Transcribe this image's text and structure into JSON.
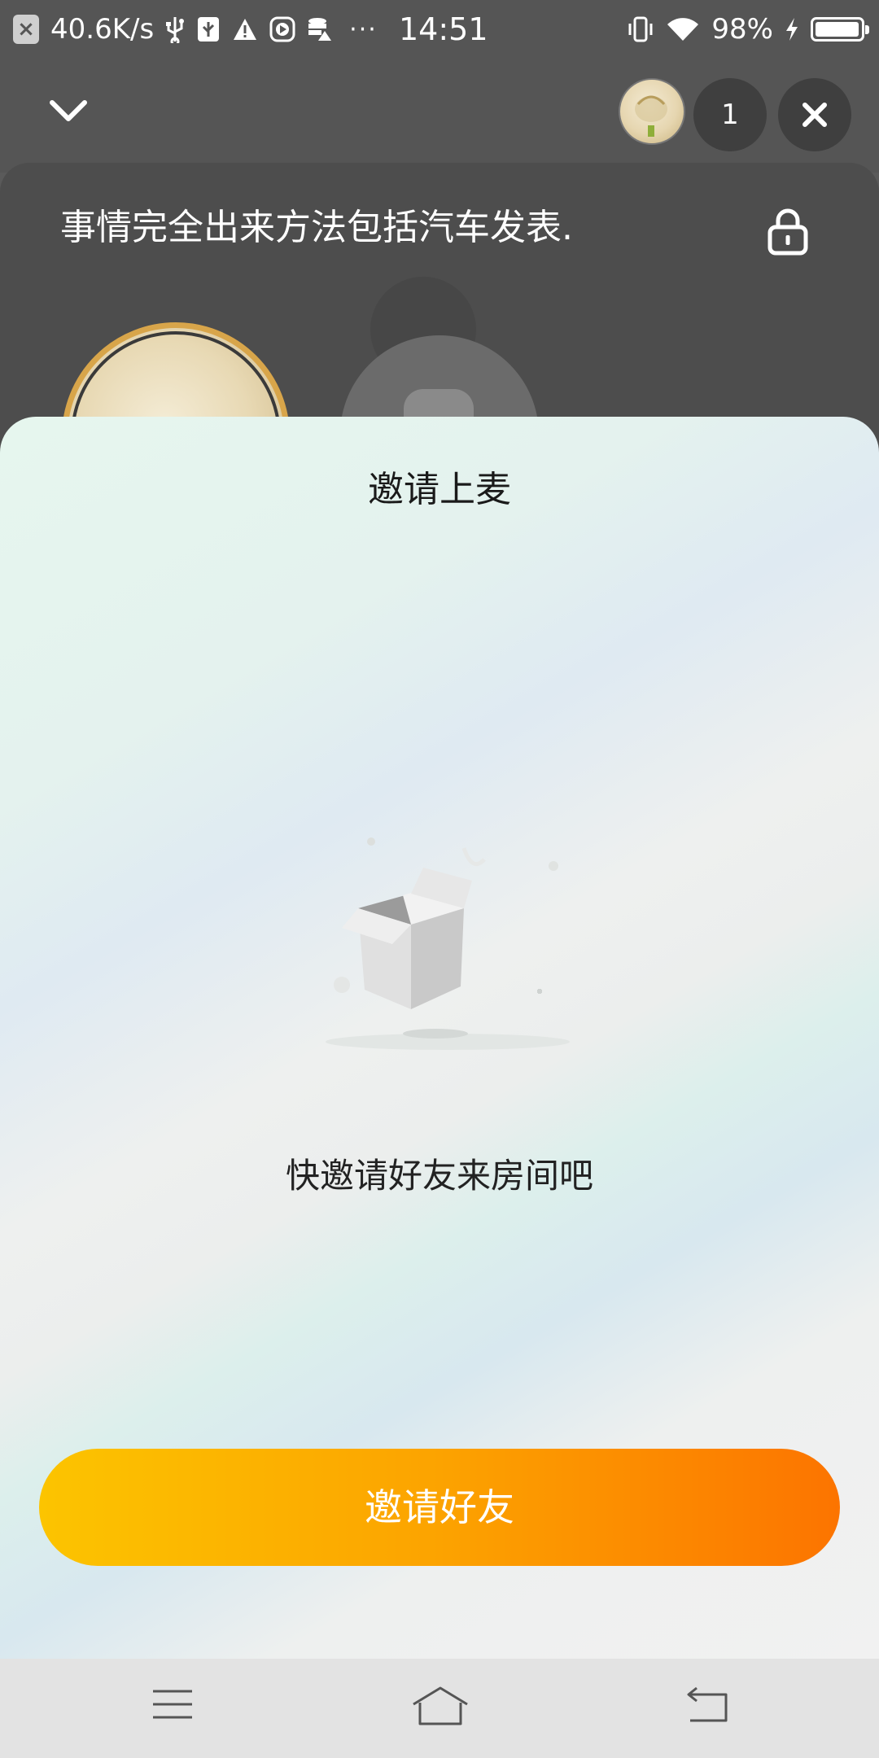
{
  "status_bar": {
    "net_speed": "40.6K/s",
    "time": "14:51",
    "battery": "98%",
    "battery_level": 0.98,
    "overflow": "···",
    "icons": [
      "close-notification-icon",
      "usb-icon",
      "usb-debug-icon",
      "warning-icon",
      "play-icon",
      "data-icon",
      "vibrate-icon",
      "wifi-icon",
      "charging-icon",
      "battery-icon"
    ]
  },
  "top_bar": {
    "online_count": "1",
    "icons": [
      "chevron-down-icon",
      "close-icon"
    ]
  },
  "room": {
    "title": "事情完全出来方法包括汽车发表.",
    "icons": [
      "lock-icon"
    ]
  },
  "sheet": {
    "title": "邀请上麦",
    "empty_text": "快邀请好友来房间吧",
    "invite_button": "邀请好友",
    "icons": [
      "empty-box-icon"
    ]
  },
  "nav_bar": {
    "icons": [
      "menu-icon",
      "home-icon",
      "back-icon"
    ]
  },
  "colors": {
    "accent_start": "#fcc400",
    "accent_end": "#fc7400",
    "dark_bg": "#555555",
    "host_ring": "#d8a54a"
  }
}
